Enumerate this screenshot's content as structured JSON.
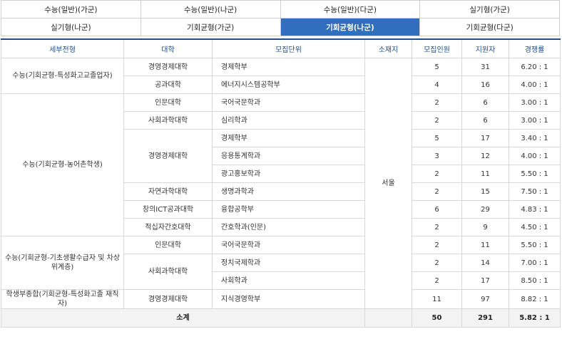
{
  "tabs": [
    [
      "수능(일반)(가군)",
      "수능(일반)(나군)",
      "수능(일반)(다군)",
      "실기형(가군)"
    ],
    [
      "실기형(나군)",
      "기회균형(가군)",
      "기회균형(나군)",
      "기회균형(다군)"
    ]
  ],
  "active_tab": "기회균형(나군)",
  "table": {
    "headers": [
      "세부전형",
      "대학",
      "모집단위",
      "소재지",
      "모집인원",
      "지원자",
      "경쟁률"
    ],
    "location": "서울",
    "groups": [
      {
        "type": "수능(기회균형-특성화고교졸업자)",
        "colleges": [
          {
            "name": "경영경제대학",
            "units": [
              {
                "name": "경제학부",
                "quota": "5",
                "applicants": "31",
                "ratio": "6.20 : 1"
              }
            ]
          },
          {
            "name": "공과대학",
            "units": [
              {
                "name": "에너지시스템공학부",
                "quota": "4",
                "applicants": "16",
                "ratio": "4.00 : 1"
              }
            ]
          }
        ]
      },
      {
        "type": "수능(기회균형-농어촌학생)",
        "colleges": [
          {
            "name": "인문대학",
            "units": [
              {
                "name": "국어국문학과",
                "quota": "2",
                "applicants": "6",
                "ratio": "3.00 : 1"
              }
            ]
          },
          {
            "name": "사회과학대학",
            "units": [
              {
                "name": "심리학과",
                "quota": "2",
                "applicants": "6",
                "ratio": "3.00 : 1"
              }
            ]
          },
          {
            "name": "경영경제대학",
            "units": [
              {
                "name": "경제학부",
                "quota": "5",
                "applicants": "17",
                "ratio": "3.40 : 1"
              },
              {
                "name": "응용통계학과",
                "quota": "3",
                "applicants": "12",
                "ratio": "4.00 : 1"
              },
              {
                "name": "광고홍보학과",
                "quota": "2",
                "applicants": "11",
                "ratio": "5.50 : 1"
              }
            ]
          },
          {
            "name": "자연과학대학",
            "units": [
              {
                "name": "생명과학과",
                "quota": "2",
                "applicants": "15",
                "ratio": "7.50 : 1"
              }
            ]
          },
          {
            "name": "창의ICT공과대학",
            "units": [
              {
                "name": "융합공학부",
                "quota": "6",
                "applicants": "29",
                "ratio": "4.83 : 1"
              }
            ]
          },
          {
            "name": "적십자간호대학",
            "units": [
              {
                "name": "간호학과(인문)",
                "quota": "2",
                "applicants": "9",
                "ratio": "4.50 : 1"
              }
            ]
          }
        ]
      },
      {
        "type": "수능(기회균형-기초생활수급자 및 차상위계층)",
        "colleges": [
          {
            "name": "인문대학",
            "units": [
              {
                "name": "국어국문학과",
                "quota": "2",
                "applicants": "11",
                "ratio": "5.50 : 1"
              }
            ]
          },
          {
            "name": "사회과학대학",
            "units": [
              {
                "name": "정치국제학과",
                "quota": "2",
                "applicants": "14",
                "ratio": "7.00 : 1"
              },
              {
                "name": "사회학과",
                "quota": "2",
                "applicants": "17",
                "ratio": "8.50 : 1"
              }
            ]
          }
        ]
      },
      {
        "type": "학생부종합(기회균형-특성화고졸 재직자)",
        "colleges": [
          {
            "name": "경영경제대학",
            "units": [
              {
                "name": "지식경영학부",
                "quota": "11",
                "applicants": "97",
                "ratio": "8.82 : 1"
              }
            ]
          }
        ]
      }
    ],
    "total": {
      "label": "소계",
      "quota": "50",
      "applicants": "291",
      "ratio": "5.82 : 1"
    }
  }
}
